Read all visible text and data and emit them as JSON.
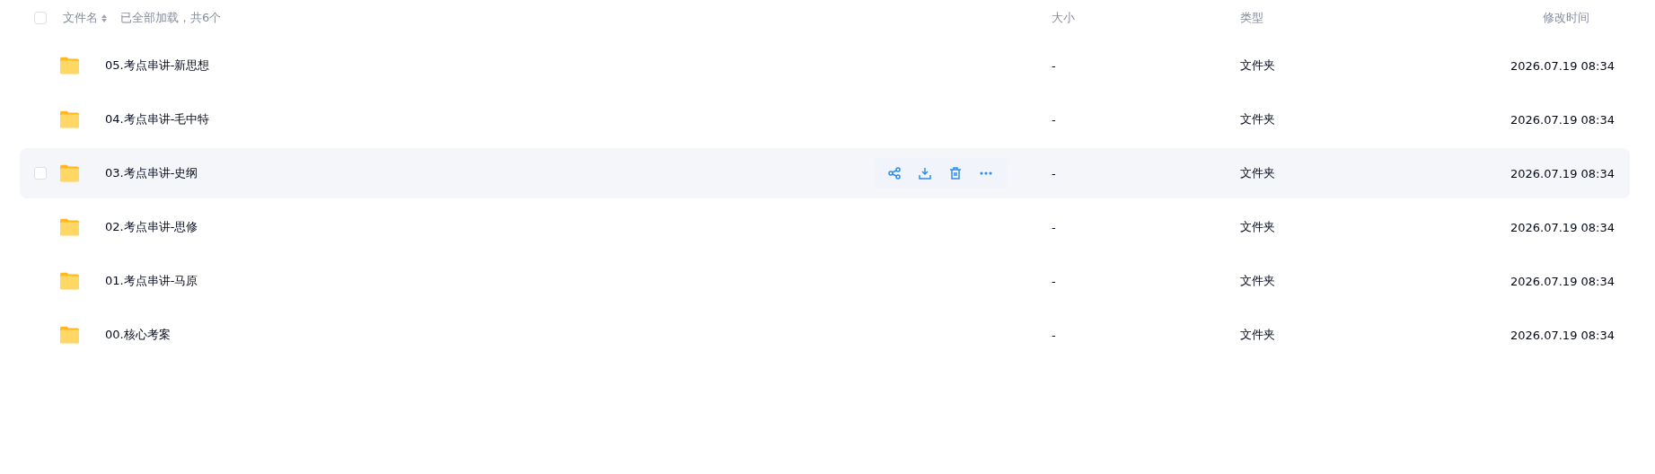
{
  "header": {
    "select_all_checked": false,
    "name_label": "文件名",
    "load_status": "已全部加载，共6个",
    "size_label": "大小",
    "type_label": "类型",
    "modified_label": "修改时间"
  },
  "files": [
    {
      "name": "05.考点串讲-新思想",
      "size": "-",
      "type": "文件夹",
      "modified": "2026.07.19 08:34",
      "hovered": false,
      "checked": false
    },
    {
      "name": "04.考点串讲-毛中特",
      "size": "-",
      "type": "文件夹",
      "modified": "2026.07.19 08:34",
      "hovered": false,
      "checked": false
    },
    {
      "name": "03.考点串讲-史纲",
      "size": "-",
      "type": "文件夹",
      "modified": "2026.07.19 08:34",
      "hovered": true,
      "checked": false
    },
    {
      "name": "02.考点串讲-思修",
      "size": "-",
      "type": "文件夹",
      "modified": "2026.07.19 08:34",
      "hovered": false,
      "checked": false
    },
    {
      "name": "01.考点串讲-马原",
      "size": "-",
      "type": "文件夹",
      "modified": "2026.07.19 08:34",
      "hovered": false,
      "checked": false
    },
    {
      "name": "00.核心考案",
      "size": "-",
      "type": "文件夹",
      "modified": "2026.07.19 08:34",
      "hovered": false,
      "checked": false
    }
  ]
}
